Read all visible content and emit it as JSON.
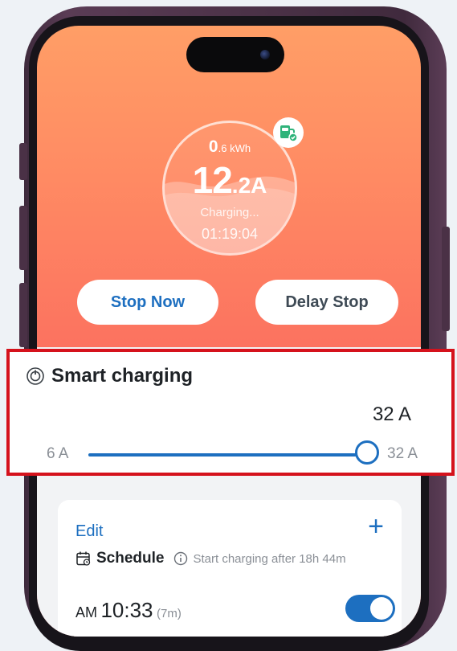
{
  "colors": {
    "accent": "#1d6fc0",
    "highlight_border": "#d5121c",
    "screen_gradient_top": "#ff9e66",
    "screen_gradient_bottom": "#f65f5c"
  },
  "gauge": {
    "energy_value": "0",
    "energy_unit": ".6 kWh",
    "current_value": "12",
    "current_unit": ".2A",
    "status": "Charging...",
    "elapsed": "01:19:04",
    "badge_icon": "ev-charger-icon"
  },
  "actions": {
    "stop_label": "Stop Now",
    "delay_label": "Delay Stop"
  },
  "smart_charging": {
    "icon": "power-dial-icon",
    "title": "Smart charging",
    "current_value": "32 A",
    "min_label": "6 A",
    "max_label": "32 A",
    "slider_min": 6,
    "slider_max": 32,
    "slider_value": 32
  },
  "schedule": {
    "edit_label": "Edit",
    "add_icon": "plus-icon",
    "calendar_icon": "calendar-icon",
    "label": "Schedule",
    "info_icon": "info-icon",
    "hint": "Start charging after 18h 44m",
    "entry": {
      "ampm": "AM",
      "time": "10:33",
      "duration": "(7m)",
      "enabled": true
    }
  }
}
